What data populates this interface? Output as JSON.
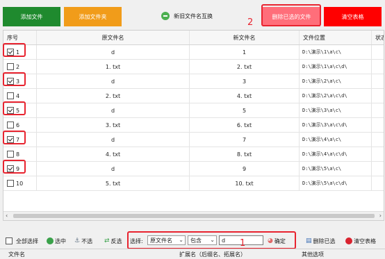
{
  "toolbar_top": {
    "add_file": "添加文件",
    "add_folder": "添加文件夹",
    "swap": "新旧文件名互换",
    "delete_selected": "删除已选的文件",
    "clear_table": "清空表格"
  },
  "markers": {
    "one": "1",
    "two": "2"
  },
  "table": {
    "headers": [
      "序号",
      "原文件名",
      "新文件名",
      "文件位置",
      "状态"
    ],
    "rows": [
      {
        "no": "1",
        "old": "d",
        "new": "1",
        "path": "D:\\演示\\1\\a\\c\\",
        "checked": true
      },
      {
        "no": "2",
        "old": "1. txt",
        "new": "2. txt",
        "path": "D:\\演示\\1\\a\\c\\d\\",
        "checked": false
      },
      {
        "no": "3",
        "old": "d",
        "new": "3",
        "path": "D:\\演示\\2\\a\\c\\",
        "checked": true
      },
      {
        "no": "4",
        "old": "2. txt",
        "new": "4. txt",
        "path": "D:\\演示\\2\\a\\c\\d\\",
        "checked": false
      },
      {
        "no": "5",
        "old": "d",
        "new": "5",
        "path": "D:\\演示\\3\\a\\c\\",
        "checked": true
      },
      {
        "no": "6",
        "old": "3. txt",
        "new": "6. txt",
        "path": "D:\\演示\\3\\a\\c\\d\\",
        "checked": false
      },
      {
        "no": "7",
        "old": "d",
        "new": "7",
        "path": "D:\\演示\\4\\a\\c\\",
        "checked": true
      },
      {
        "no": "8",
        "old": "4. txt",
        "new": "8. txt",
        "path": "D:\\演示\\4\\a\\c\\d\\",
        "checked": false
      },
      {
        "no": "9",
        "old": "d",
        "new": "9",
        "path": "D:\\演示\\5\\a\\c\\",
        "checked": true
      },
      {
        "no": "10",
        "old": "5. txt",
        "new": "10. txt",
        "path": "D:\\演示\\5\\a\\c\\d\\",
        "checked": false
      }
    ]
  },
  "bottom_bar": {
    "select_all": "全部选择",
    "select_mid": "选中",
    "deselect": "不选",
    "invert": "反选",
    "choose_label": "选择:",
    "field_value": "原文件名",
    "match_value": "包含",
    "search_value": "d",
    "confirm": "确定",
    "delete_selected": "删除已选",
    "clear_table": "清空表格"
  },
  "footer": {
    "file_name": "文件名",
    "extension": "扩展名（后缀名、拓展名）",
    "other": "其他选项"
  },
  "colors": {
    "green": "#1f8a2e",
    "orange": "#f19c1a",
    "pink": "#ff6e7a",
    "red": "#ff0000",
    "annotation": "#e8232f"
  }
}
